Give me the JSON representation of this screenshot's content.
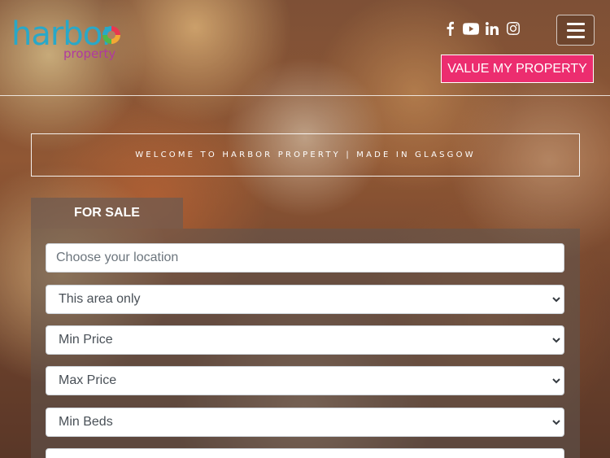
{
  "brand": {
    "wordmark": "harbor",
    "tagline": "property",
    "colors": {
      "teal": "#29a8c8",
      "magenta": "#b03aa0",
      "cta": "#ec2d6f"
    }
  },
  "social": [
    {
      "name": "facebook",
      "icon": "facebook-icon"
    },
    {
      "name": "youtube",
      "icon": "youtube-icon"
    },
    {
      "name": "linkedin",
      "icon": "linkedin-icon"
    },
    {
      "name": "instagram",
      "icon": "instagram-icon"
    }
  ],
  "header": {
    "cta_label": "VALUE MY PROPERTY",
    "menu_icon": "hamburger-icon"
  },
  "welcome": {
    "text": "WELCOME TO HARBOR PROPERTY | MADE IN GLASGOW"
  },
  "search": {
    "tab_label": "FOR SALE",
    "location_placeholder": "Choose your location",
    "radius_value": "This area only",
    "min_price_value": "Min Price",
    "max_price_value": "Max Price",
    "min_beds_value": "Min Beds"
  }
}
